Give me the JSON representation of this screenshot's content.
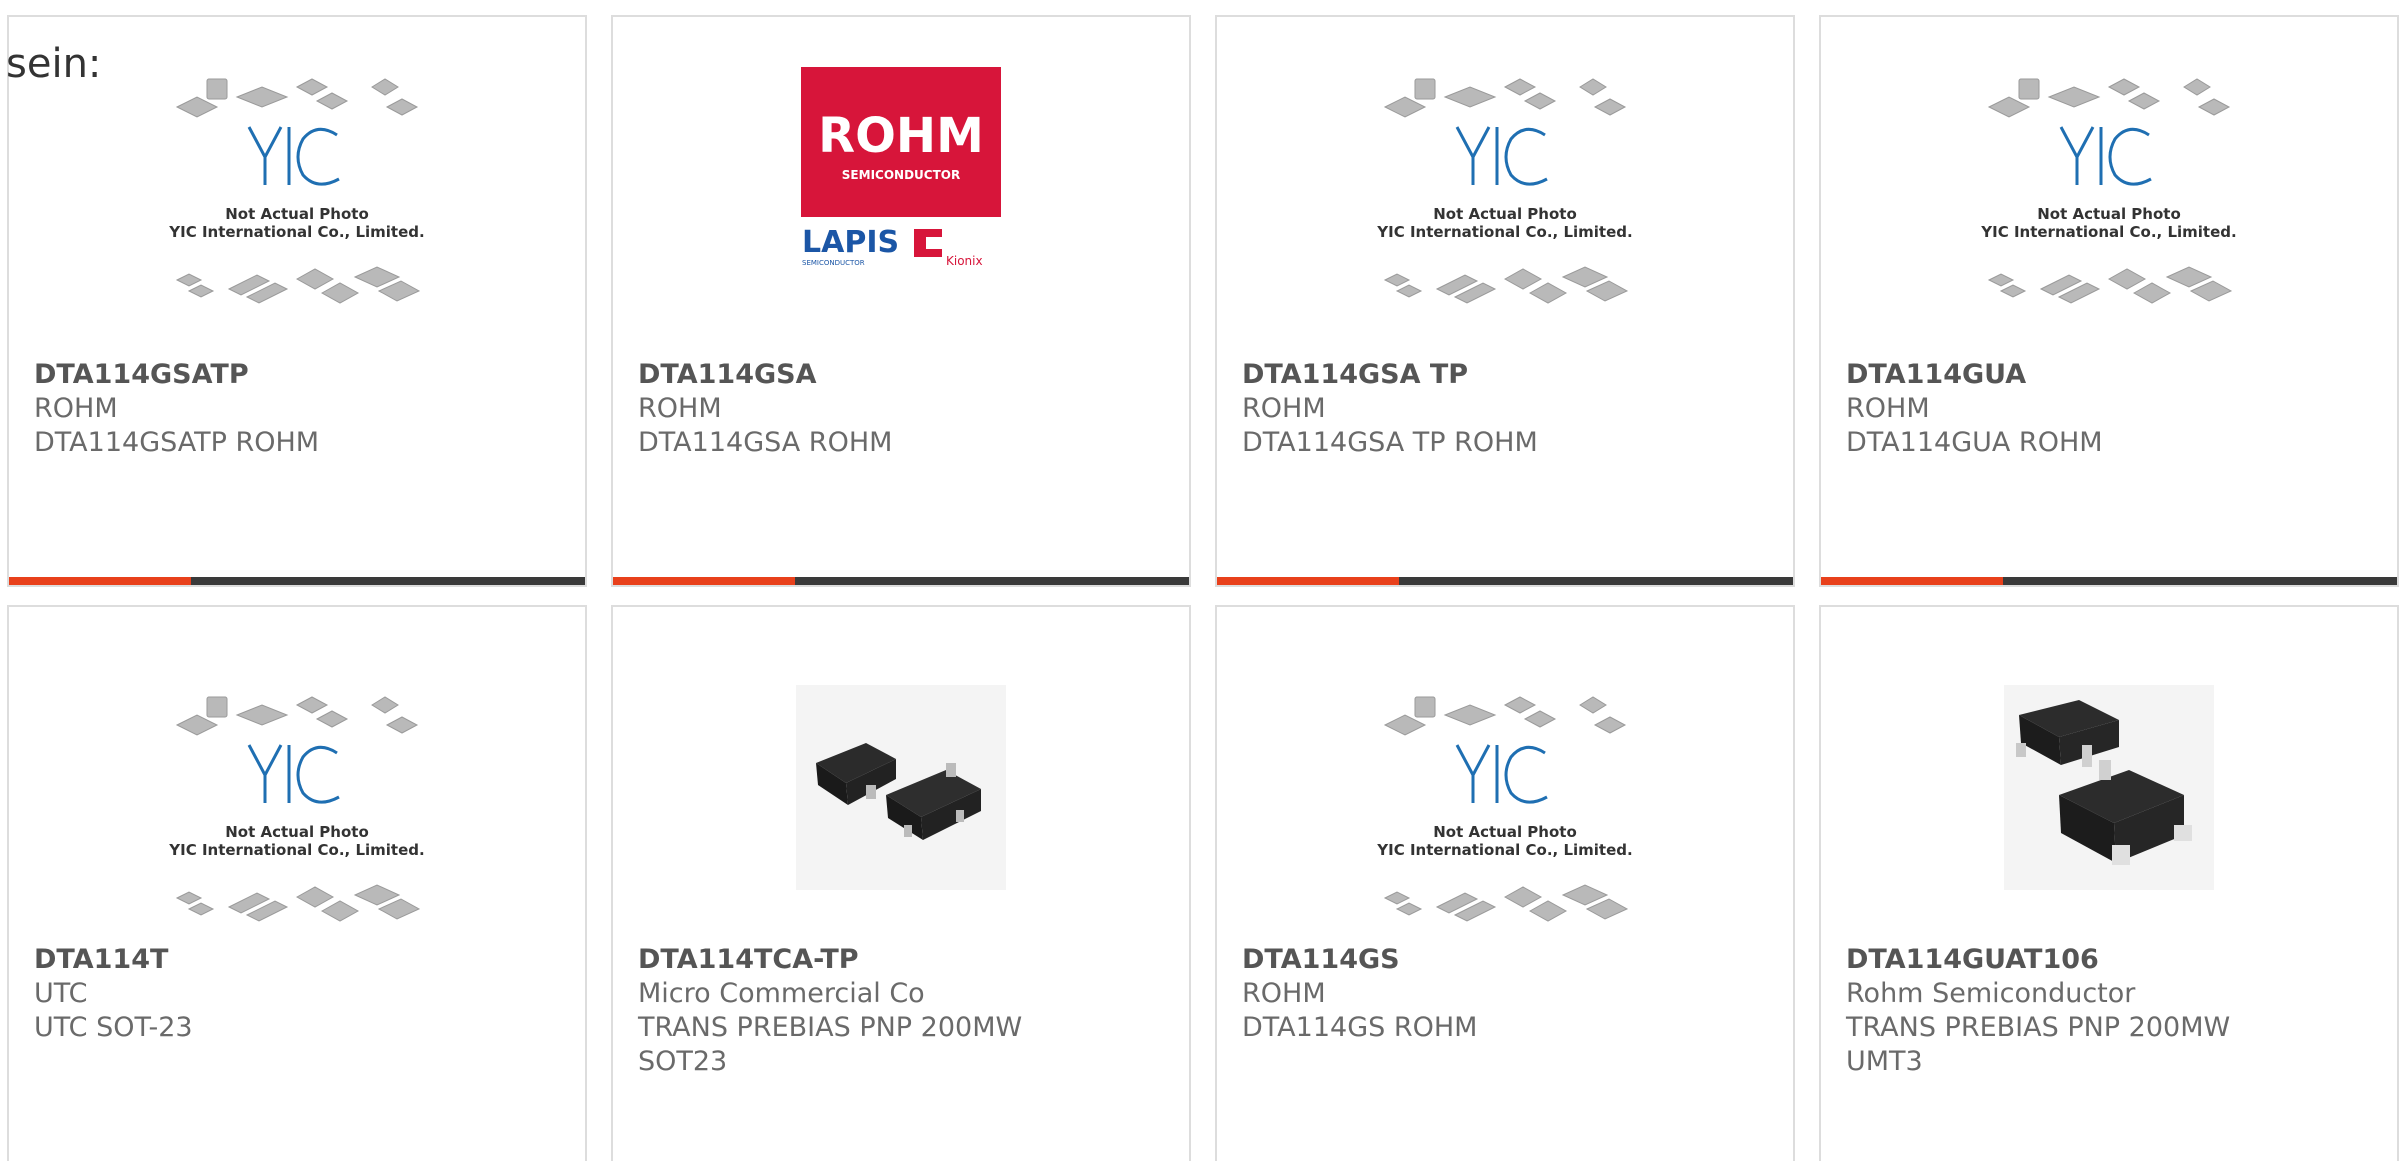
{
  "intro": "sein:",
  "placeholder_caption": {
    "line1": "Not Actual Photo",
    "line2": "YIC International Co., Limited.",
    "logo": "YIC"
  },
  "rohm_logo": {
    "brand": "ROHM",
    "sub": "SEMICONDUCTOR",
    "partner1": "LAPIS",
    "partner1_sub": "SEMICONDUCTOR",
    "partner2": "Kionix"
  },
  "colors": {
    "accent": "#e8401b",
    "bar": "#3a3a3a",
    "rohm_red": "#d7153a",
    "yic_blue": "#1f6fb2"
  },
  "products": [
    {
      "part": "DTA114GSATP",
      "maker": "ROHM",
      "desc1": "DTA114GSATP ROHM",
      "desc2": "",
      "image": "yic-placeholder"
    },
    {
      "part": "DTA114GSA",
      "maker": "ROHM",
      "desc1": "DTA114GSA ROHM",
      "desc2": "",
      "image": "rohm-logo"
    },
    {
      "part": "DTA114GSA TP",
      "maker": "ROHM",
      "desc1": "DTA114GSA TP ROHM",
      "desc2": "",
      "image": "yic-placeholder"
    },
    {
      "part": "DTA114GUA",
      "maker": "ROHM",
      "desc1": "DTA114GUA ROHM",
      "desc2": "",
      "image": "yic-placeholder"
    },
    {
      "part": "DTA114T",
      "maker": "UTC",
      "desc1": "UTC SOT-23",
      "desc2": "",
      "image": "yic-placeholder"
    },
    {
      "part": "DTA114TCA-TP",
      "maker": "Micro Commercial Co",
      "desc1": "TRANS PREBIAS PNP 200MW",
      "desc2": "SOT23",
      "image": "sot23-photo"
    },
    {
      "part": "DTA114GS",
      "maker": "ROHM",
      "desc1": "DTA114GS ROHM",
      "desc2": "",
      "image": "yic-placeholder"
    },
    {
      "part": "DTA114GUAT106",
      "maker": "Rohm Semiconductor",
      "desc1": "TRANS PREBIAS PNP 200MW",
      "desc2": "UMT3",
      "image": "umt3-photo"
    }
  ]
}
